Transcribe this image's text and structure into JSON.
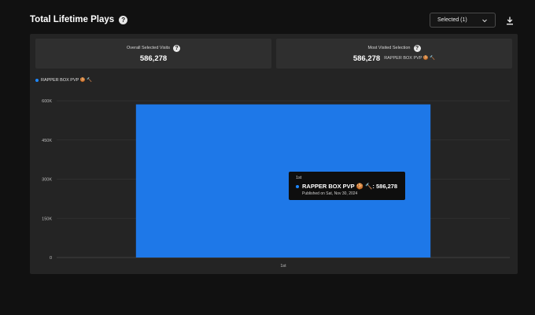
{
  "header": {
    "title": "Total Lifetime Plays",
    "help_glyph": "?",
    "select_value": "Selected (1)"
  },
  "stats": {
    "overall_label": "Overall Selected Visits",
    "overall_value": "586,278",
    "most_label": "Most Visited Selection",
    "most_value": "586,278",
    "most_name": "RAPPER BOX PVP 🍪 🔨"
  },
  "legend": {
    "series_name": "RAPPER BOX PVP 🍪 🔨"
  },
  "tooltip": {
    "header": "1st",
    "series_line": "RAPPER BOX PVP 🍪 🔨: 586,278",
    "published": "Published on Sat, Nov 30, 2024"
  },
  "chart_data": {
    "type": "bar",
    "categories": [
      "1st"
    ],
    "series": [
      {
        "name": "RAPPER BOX PVP 🍪 🔨",
        "values": [
          586278
        ]
      }
    ],
    "yticks": [
      0,
      150000,
      300000,
      450000,
      600000
    ],
    "ytick_labels": [
      "0",
      "150K",
      "300K",
      "450K",
      "600K"
    ],
    "ylim": [
      0,
      600000
    ],
    "color": "#1e78e8"
  }
}
